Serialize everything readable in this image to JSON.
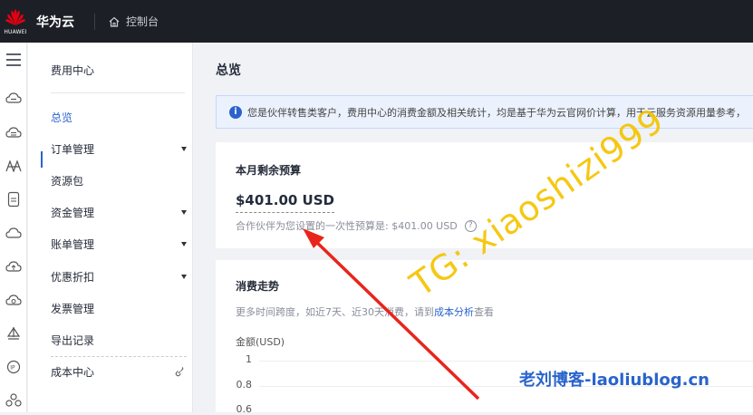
{
  "topbar": {
    "logo_text": "HUAWEI",
    "brand": "华为云",
    "console_label": "控制台",
    "brand_color": "#e60012"
  },
  "sidenav": {
    "title": "费用中心",
    "items": [
      {
        "label": "总览",
        "active": true
      },
      {
        "label": "订单管理",
        "expandable": true
      },
      {
        "label": "资源包"
      },
      {
        "label": "资金管理",
        "expandable": true
      },
      {
        "label": "账单管理",
        "expandable": true
      },
      {
        "label": "优惠折扣",
        "expandable": true
      },
      {
        "label": "发票管理"
      },
      {
        "label": "导出记录"
      },
      {
        "label": "成本中心",
        "external": true
      }
    ]
  },
  "iconbar": {
    "icons": [
      "menu-icon",
      "cloud-server-icon",
      "cloud-db-icon",
      "network-icon",
      "storage-icon",
      "cloud-icon",
      "cloud-upload-icon",
      "cloud-sync-icon",
      "sail-icon",
      "ip-icon",
      "cluster-icon"
    ]
  },
  "main": {
    "page_title": "总览",
    "notice": "您是伙伴转售类客户，费用中心的消费金额及相关统计，均是基于华为云官网价计算，用于云服务资源用量参考，",
    "budget": {
      "title": "本月剩余预算",
      "amount": "$401.00 USD",
      "desc": "合作伙伴为您设置的一次性预算是: $401.00 USD",
      "help": "?"
    },
    "trend": {
      "title": "消费走势",
      "desc_prefix": "更多时间跨度，如近7天、近30天消费，请到",
      "desc_link": "成本分析",
      "desc_suffix": "查看",
      "ylabel": "金额(USD)",
      "ticks": [
        "1",
        "0.8",
        "0.6"
      ]
    }
  },
  "watermark": {
    "handle": "TG: xiaoshizi999",
    "blog": "老刘博客-laoliublog.cn",
    "handle_color": "#f5c400",
    "arrow_color": "#e8251c"
  }
}
